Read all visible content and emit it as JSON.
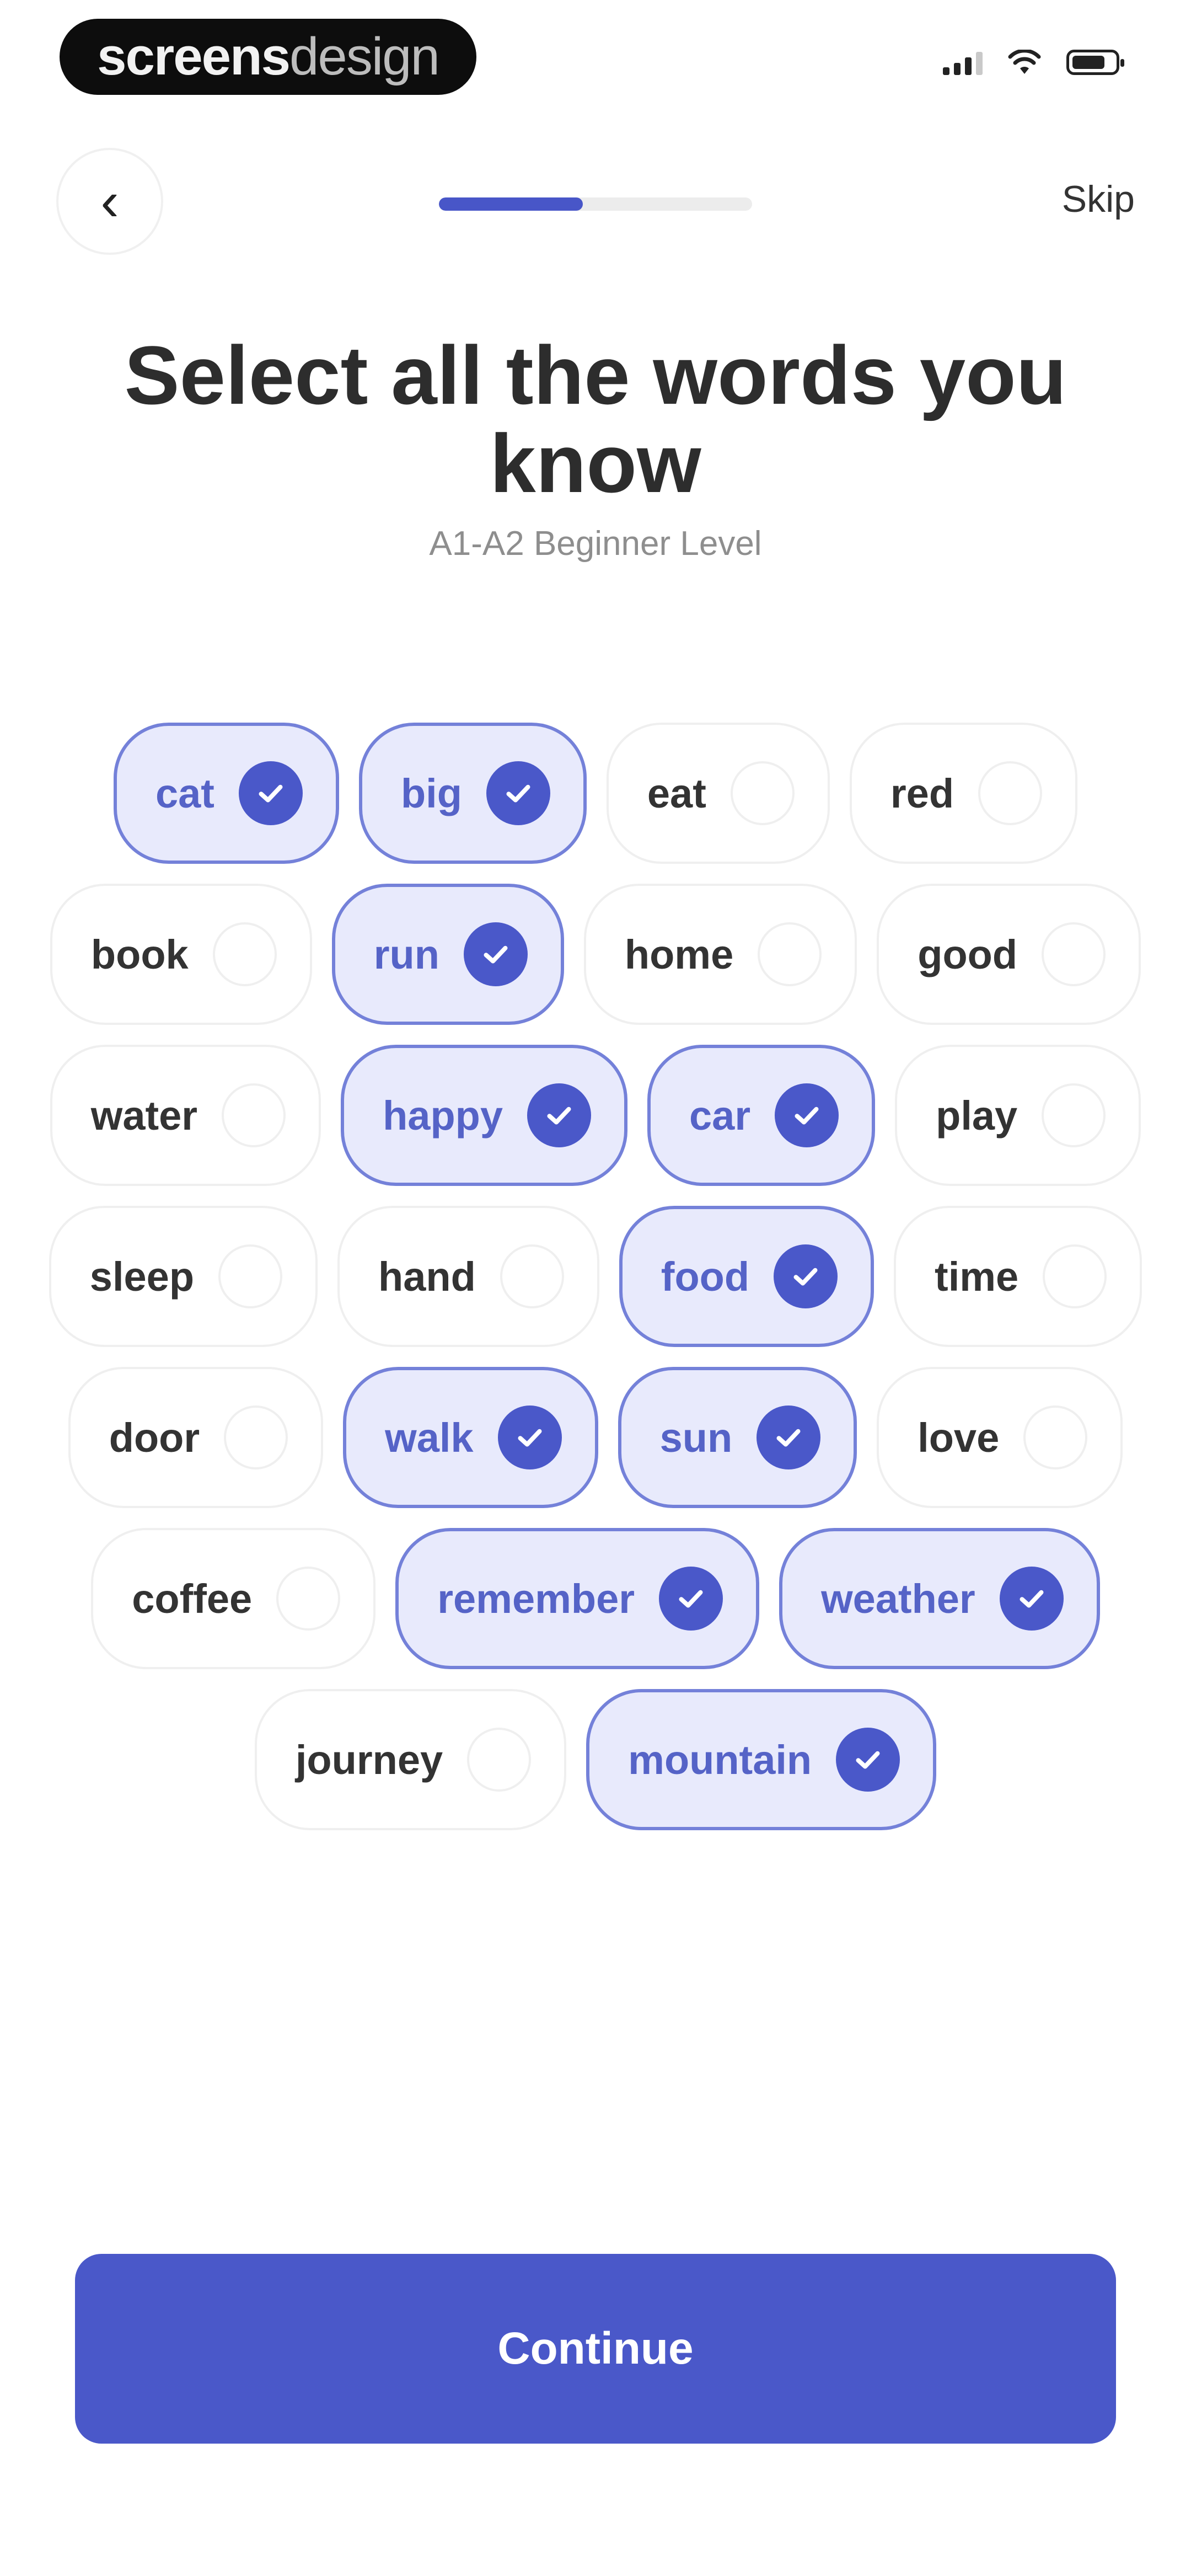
{
  "status_bar": {
    "brand_bold": "screens",
    "brand_light": "design"
  },
  "nav": {
    "back_icon": "chevron-left-icon",
    "progress_percent": 46,
    "skip_label": "Skip"
  },
  "title": "Select all the words you know",
  "subtitle": "A1-A2 Beginner Level",
  "word_rows": [
    [
      {
        "word": "cat",
        "selected": true
      },
      {
        "word": "big",
        "selected": true
      },
      {
        "word": "eat",
        "selected": false
      },
      {
        "word": "red",
        "selected": false
      }
    ],
    [
      {
        "word": "book",
        "selected": false
      },
      {
        "word": "run",
        "selected": true
      },
      {
        "word": "home",
        "selected": false
      },
      {
        "word": "good",
        "selected": false
      }
    ],
    [
      {
        "word": "water",
        "selected": false
      },
      {
        "word": "happy",
        "selected": true
      },
      {
        "word": "car",
        "selected": true
      },
      {
        "word": "play",
        "selected": false
      }
    ],
    [
      {
        "word": "sleep",
        "selected": false
      },
      {
        "word": "hand",
        "selected": false
      },
      {
        "word": "food",
        "selected": true
      },
      {
        "word": "time",
        "selected": false
      }
    ],
    [
      {
        "word": "door",
        "selected": false
      },
      {
        "word": "walk",
        "selected": true
      },
      {
        "word": "sun",
        "selected": true
      },
      {
        "word": "love",
        "selected": false
      }
    ],
    [
      {
        "word": "coffee",
        "selected": false
      },
      {
        "word": "remember",
        "selected": true
      },
      {
        "word": "weather",
        "selected": true
      }
    ],
    [
      {
        "word": "journey",
        "selected": false
      },
      {
        "word": "mountain",
        "selected": true
      }
    ]
  ],
  "continue_label": "Continue",
  "colors": {
    "accent": "#4a58c9",
    "selected_bg": "#e8eafc",
    "selected_border": "#7481d9"
  }
}
